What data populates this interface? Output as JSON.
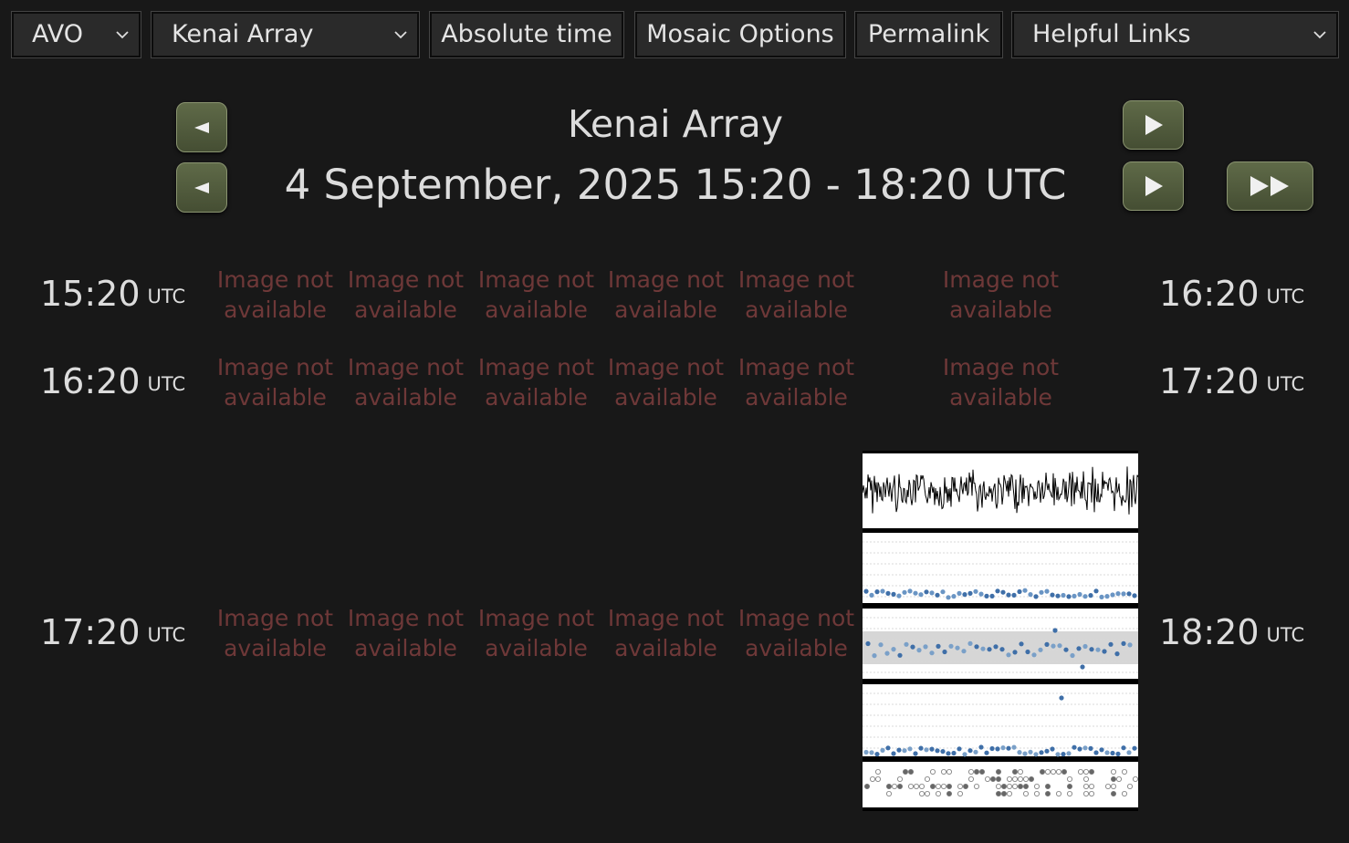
{
  "toolbar": {
    "network_select": "AVO",
    "subnet_select": "Kenai Array",
    "absolute_time_label": "Absolute time",
    "mosaic_options_label": "Mosaic Options",
    "permalink_label": "Permalink",
    "helpful_links_label": "Helpful Links"
  },
  "header": {
    "subnet_title": "Kenai Array",
    "time_range": "4 September, 2025 15:20 - 18:20 UTC"
  },
  "rows": [
    {
      "start": "15:20",
      "end": "16:20",
      "unit": "UTC",
      "cells": [
        "Image not available",
        "Image not available",
        "Image not available",
        "Image not available",
        "Image not available",
        "Image not available"
      ]
    },
    {
      "start": "16:20",
      "end": "17:20",
      "unit": "UTC",
      "cells": [
        "Image not available",
        "Image not available",
        "Image not available",
        "Image not available",
        "Image not available",
        "Image not available"
      ]
    },
    {
      "start": "17:20",
      "end": "18:20",
      "unit": "UTC",
      "cells": [
        "Image not available",
        "Image not available",
        "Image not available",
        "Image not available",
        "Image not available"
      ]
    }
  ],
  "colors": {
    "background": "#181818",
    "nav_button": "#56603f",
    "unavailable_text": "#6e3838"
  },
  "icons": {
    "dropdown": "chevron-down-icon",
    "prev": "left-triangle-icon",
    "next": "play-icon",
    "fast_forward": "fast-forward-icon"
  }
}
